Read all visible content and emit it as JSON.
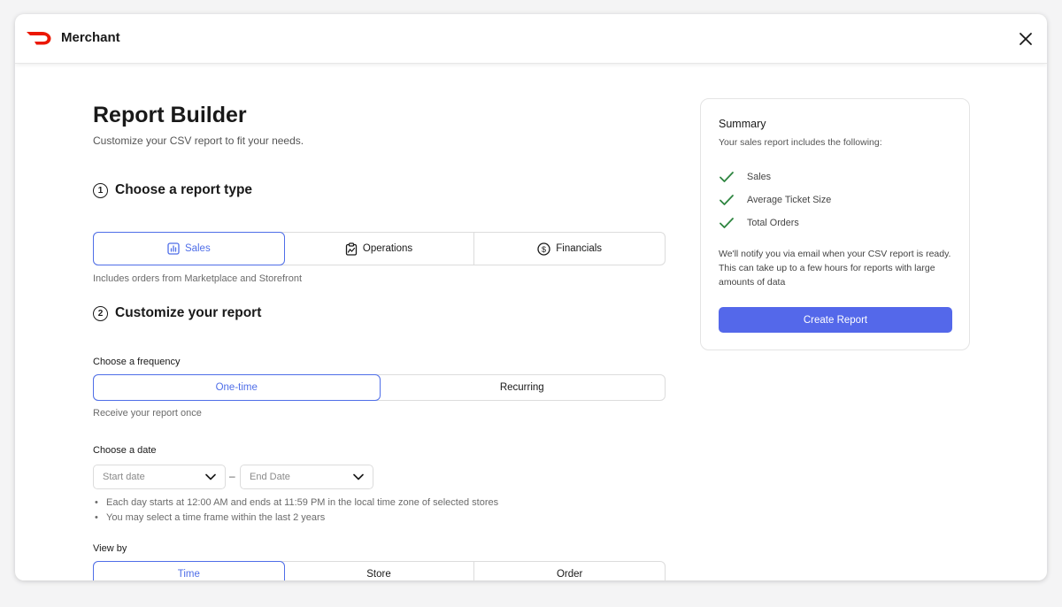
{
  "app": {
    "title": "Merchant"
  },
  "page": {
    "title": "Report Builder",
    "subtitle": "Customize your CSV report to fit your needs."
  },
  "step1": {
    "number": "1",
    "heading": "Choose a report type",
    "options": [
      {
        "label": "Sales",
        "icon": "bar-chart-icon",
        "active": true
      },
      {
        "label": "Operations",
        "icon": "clipboard-icon",
        "active": false
      },
      {
        "label": "Financials",
        "icon": "dollar-circle-icon",
        "active": false
      }
    ],
    "helper": "Includes orders from Marketplace and Storefront"
  },
  "step2": {
    "number": "2",
    "heading": "Customize your report",
    "frequency": {
      "label": "Choose a frequency",
      "options": [
        {
          "label": "One-time",
          "active": true
        },
        {
          "label": "Recurring",
          "active": false
        }
      ],
      "helper": "Receive your report once"
    },
    "date": {
      "label": "Choose a date",
      "start_placeholder": "Start date",
      "end_placeholder": "End Date",
      "separator": "–",
      "notes": [
        "Each day starts at 12:00 AM and ends at 11:59 PM in the local time zone of selected stores",
        "You may select a time frame within the last 2 years"
      ]
    },
    "view_by": {
      "label": "View by",
      "options": [
        {
          "label": "Time",
          "active": true
        },
        {
          "label": "Store",
          "active": false
        },
        {
          "label": "Order",
          "active": false
        }
      ]
    }
  },
  "summary": {
    "title": "Summary",
    "subtitle": "Your sales report includes the following:",
    "items": [
      "Sales",
      "Average Ticket Size",
      "Total Orders"
    ],
    "note": "We'll notify you via email when your CSV report is ready. This can take up to a few hours for reports with large amounts of data",
    "button_label": "Create Report"
  },
  "colors": {
    "accent": "#4f6ee8",
    "button": "#5468ea",
    "brand": "#eb1700",
    "check": "#2e8540"
  }
}
